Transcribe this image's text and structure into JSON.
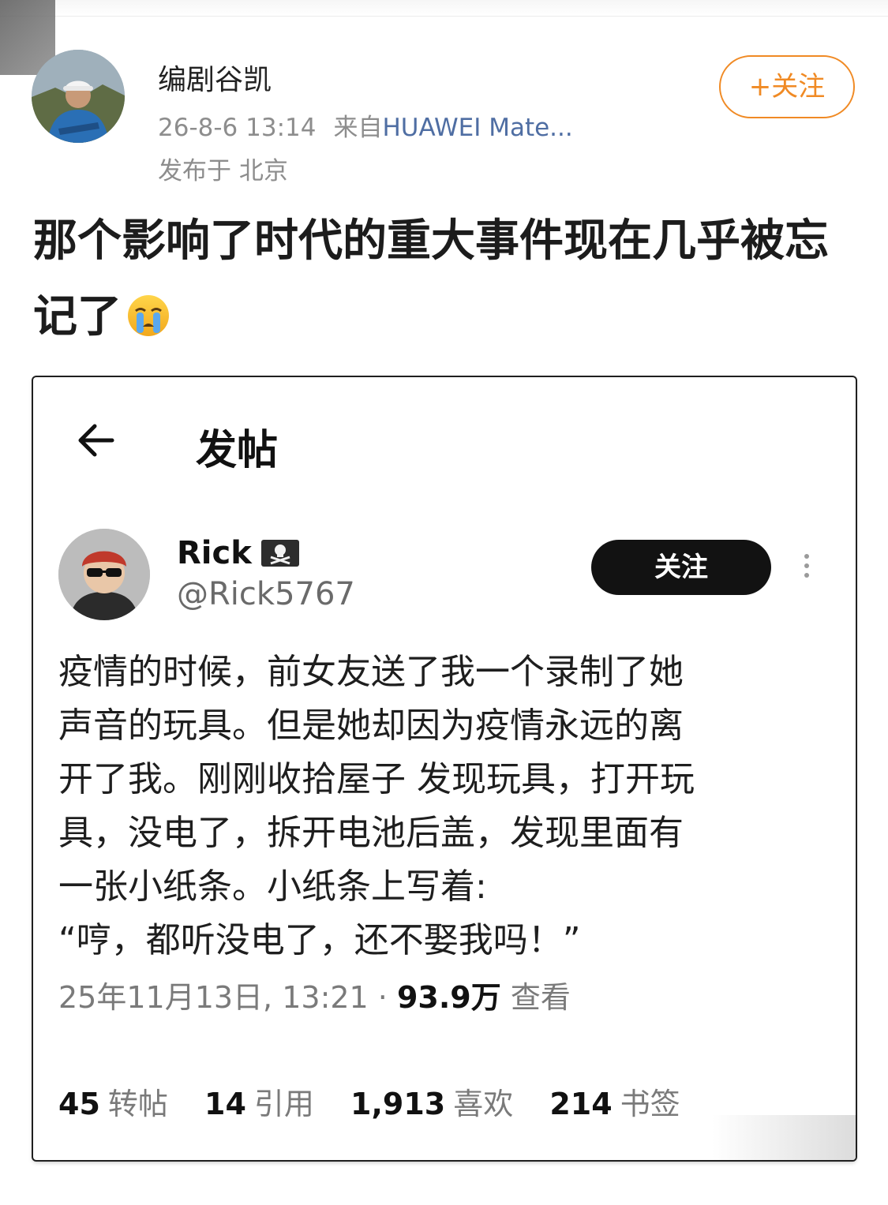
{
  "post": {
    "author": "编剧谷凯",
    "timestamp": "26-8-6 13:14",
    "source_prefix": "来自",
    "device": "HUAWEI Mate...",
    "location": "发布于 北京",
    "follow_label": "+关注",
    "text": "那个影响了时代的重大事件现在几乎被忘记了",
    "emoji": "crying-face-icon"
  },
  "screenshot": {
    "title": "发帖",
    "author_name": "Rick",
    "author_handle": "@Rick5767",
    "follow_label": "关注",
    "body": "疫情的时候，前女友送了我一个录制了她\n声音的玩具。但是她却因为疫情永远的离\n开了我。刚刚收拾屋子 发现玩具，打开玩\n具，没电了，拆开电池后盖，发现里面有\n一张小纸条。小纸条上写着:\n“哼，都听没电了，还不娶我吗！”",
    "date": "25年11月13日, 13:21 ·",
    "views_count": "93.9万",
    "views_label": "查看",
    "stats": [
      {
        "count": "45",
        "label": "转帖"
      },
      {
        "count": "14",
        "label": "引用"
      },
      {
        "count": "1,913",
        "label": "喜欢"
      },
      {
        "count": "214",
        "label": "书签"
      }
    ]
  },
  "colors": {
    "accent": "#f08a24",
    "device_link": "#4f6ea3"
  }
}
